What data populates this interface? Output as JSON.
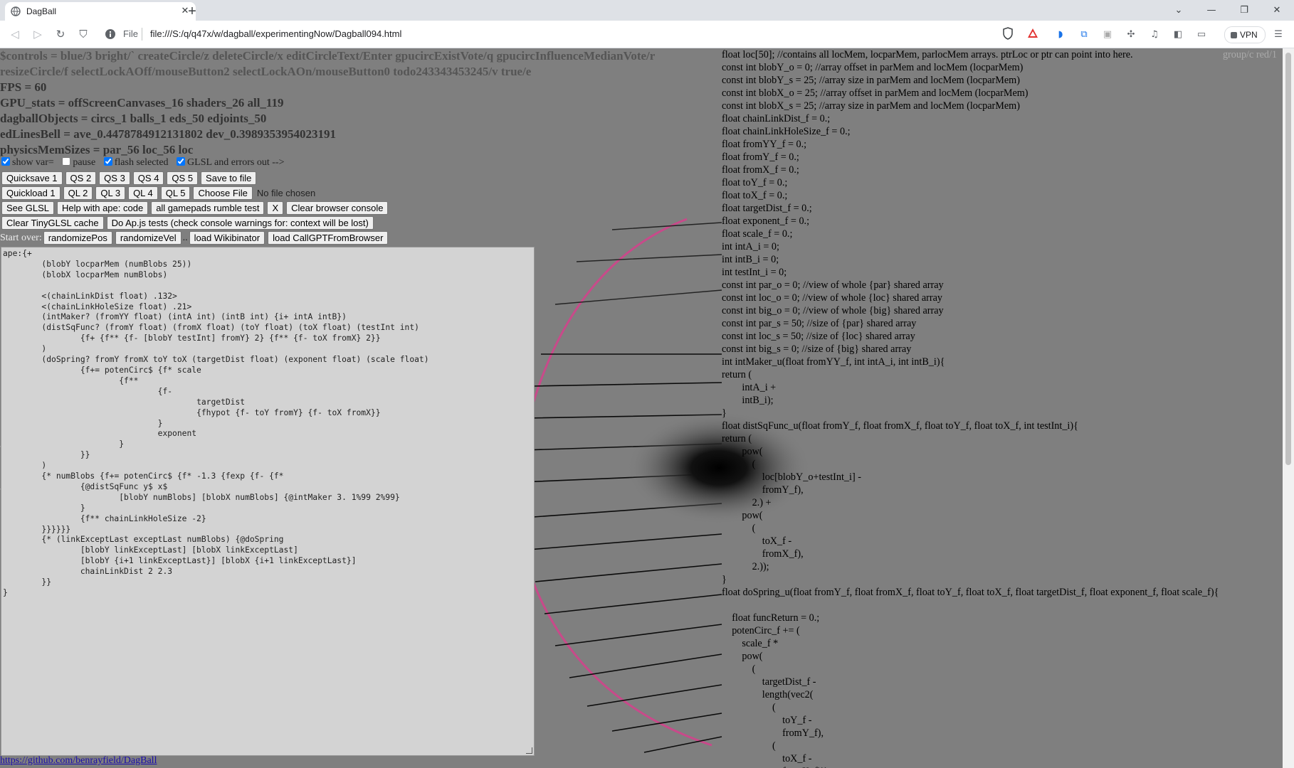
{
  "browser": {
    "tab_title": "DagBall",
    "url_scheme": "File",
    "url": "file:///S:/q/q47x/w/dagball/experimentingNow/Dagball094.html",
    "vpn_label": "VPN",
    "tab_close": "✕",
    "new_tab": "+",
    "window_controls": [
      "⌄",
      "—",
      "❐",
      "✕"
    ]
  },
  "stats": {
    "controls": "$controls = blue/3 bright/` createCircle/z deleteCircle/x editCircleText/Enter gpucircExistVote/q gpucircInfluenceMedianVote/r resizeCircle/f selectLockAOff/mouseButton2 selectLockAOn/mouseButton0 todo243343453245/v true/e",
    "controls_overflow": "group/c red/1",
    "fps": "FPS = 60",
    "gpu_stats": "GPU_stats = offScreenCanvases_16 shaders_26 all_119",
    "dagball_objects": "dagballObjects = circs_1 balls_1 eds_50 edjoints_50",
    "ed_lines_bell": "edLinesBell = ave_0.4478784912131802 dev_0.3989353954023191",
    "physics_mem": "physicsMemSizes = par_56 loc_56 loc"
  },
  "checkboxes": [
    {
      "label": "show var=",
      "checked": true
    },
    {
      "label": "pause",
      "checked": false
    },
    {
      "label": "flash selected",
      "checked": true
    },
    {
      "label": "GLSL and errors out -->",
      "checked": true
    }
  ],
  "buttons": {
    "row1": [
      "Quicksave 1",
      "QS 2",
      "QS 3",
      "QS 4",
      "QS 5",
      "Save to file"
    ],
    "row2": [
      "Quickload 1",
      "QL 2",
      "QL 3",
      "QL 4",
      "QL 5",
      "Choose File"
    ],
    "no_file": "No file chosen",
    "row3": [
      "See GLSL",
      "Help with ape: code",
      "all gamepads rumble test",
      "X",
      "Clear browser console"
    ],
    "row4": [
      "Clear TinyGLSL cache",
      "Do Ap.js tests (check console warnings for: context will be lost)"
    ],
    "start_over": "Start over:",
    "row5": [
      "randomizePos",
      "randomizeVel",
      "..",
      "load Wikibinator",
      "load CallGPTFromBrowser"
    ]
  },
  "editor_text": "ape:{+\n\t(blobY locparMem (numBlobs 25))\n\t(blobX locparMem numBlobs)\n\n\t<(chainLinkDist float) .132>\n\t<(chainLinkHoleSize float) .21>\n\t(intMaker? (fromYY float) (intA int) (intB int) {i+ intA intB})\n\t(distSqFunc? (fromY float) (fromX float) (toY float) (toX float) (testInt int)\n\t\t{f+ {f** {f- [blobY testInt] fromY} 2} {f** {f- toX fromX} 2}}\n\t)\n\t(doSpring? fromY fromX toY toX (targetDist float) (exponent float) (scale float)\n\t\t{f+= potenCirc$ {f* scale\n\t\t\t{f**\n\t\t\t\t{f-\n\t\t\t\t\ttargetDist\n\t\t\t\t\t{fhypot {f- toY fromY} {f- toX fromX}}\n\t\t\t\t}\n\t\t\t\texponent\n\t\t\t}\n\t\t}}\n\t)\n\t{* numBlobs {f+= potenCirc$ {f* -1.3 {fexp {f- {f*\n\t\t{@distSqFunc y$ x$\n\t\t\t[blobY numBlobs] [blobX numBlobs] {@intMaker 3. 1%99 2%99}\n\t\t}\n\t\t{f** chainLinkHoleSize -2}\n\t}}}}}}\n\t{* (linkExceptLast exceptLast numBlobs) {@doSpring\n\t\t[blobY linkExceptLast] [blobX linkExceptLast]\n\t\t[blobY {i+1 linkExceptLast}] [blobX {i+1 linkExceptLast}]\n\t\tchainLinkDist 2 2.3\n\t}}\n}",
  "github_link": "https://github.com/benrayfield/DagBall",
  "glsl_text": "float loc[50]; //contains all locMem, locparMem, parlocMem arrays. ptrLoc or ptr can point into here.\nconst int blobY_o = 0; //array offset in parMem and locMem (locparMem)\nconst int blobY_s = 25; //array size in parMem and locMem (locparMem)\nconst int blobX_o = 25; //array offset in parMem and locMem (locparMem)\nconst int blobX_s = 25; //array size in parMem and locMem (locparMem)\nfloat chainLinkDist_f = 0.;\nfloat chainLinkHoleSize_f = 0.;\nfloat fromYY_f = 0.;\nfloat fromY_f = 0.;\nfloat fromX_f = 0.;\nfloat toY_f = 0.;\nfloat toX_f = 0.;\nfloat targetDist_f = 0.;\nfloat exponent_f = 0.;\nfloat scale_f = 0.;\nint intA_i = 0;\nint intB_i = 0;\nint testInt_i = 0;\nconst int par_o = 0; //view of whole {par} shared array\nconst int loc_o = 0; //view of whole {loc} shared array\nconst int big_o = 0; //view of whole {big} shared array\nconst int par_s = 50; //size of {par} shared array\nconst int loc_s = 50; //size of {loc} shared array\nconst int big_s = 0; //size of {big} shared array\nint intMaker_u(float fromYY_f, int intA_i, int intB_i){\nreturn (\n        intA_i +\n        intB_i);\n}\nfloat distSqFunc_u(float fromY_f, float fromX_f, float toY_f, float toX_f, int testInt_i){\nreturn (\n        pow(\n            (\n                loc[blobY_o+testInt_i] -\n                fromY_f),\n            2.) +\n        pow(\n            (\n                toX_f -\n                fromX_f),\n            2.));\n}\nfloat doSpring_u(float fromY_f, float fromX_f, float toY_f, float toX_f, float targetDist_f, float exponent_f, float scale_f){\n\n    float funcReturn = 0.;\n    potenCirc_f += (\n        scale_f *\n        pow(\n            (\n                targetDist_f -\n                length(vec2(\n                    (\n                        toY_f -\n                        fromY_f),\n                    (\n                        toX_f -\n                        fromX_f)))\n"
}
